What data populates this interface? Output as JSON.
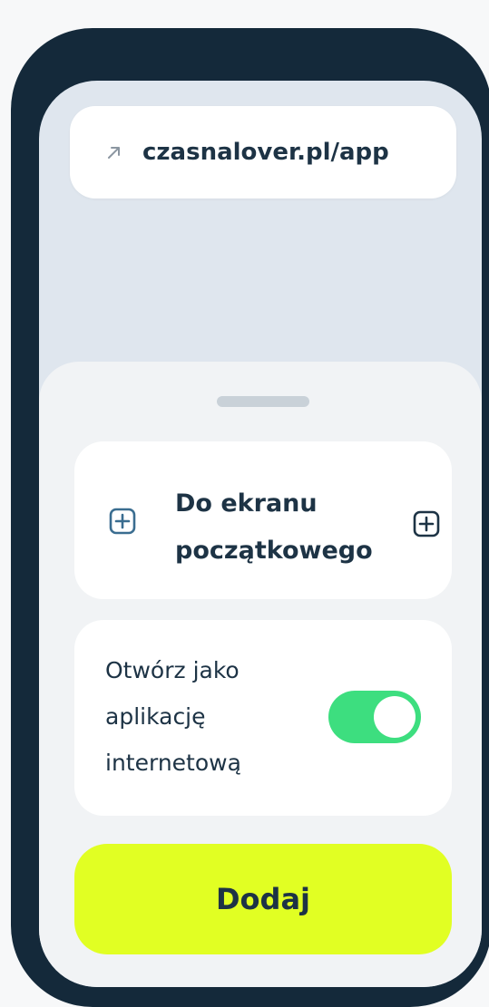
{
  "browser": {
    "url_display": "czasnalover.pl/app",
    "link_icon": "arrow-up-right-icon"
  },
  "sheet": {
    "home_screen": {
      "title": "Do ekranu początkowego",
      "left_icon": "plus-square-icon",
      "right_icon": "plus-square-icon"
    },
    "web_app_option": {
      "label": "Otwórz jako aplikację internetową",
      "toggle_on": true
    },
    "add_button_label": "Dodaj"
  },
  "colors": {
    "frame": "#14293a",
    "screen_bg": "#dfe6ee",
    "sheet_bg": "#f1f3f5",
    "text": "#1d3345",
    "toggle_on": "#3dde7f",
    "accent_button": "#e1ff23"
  }
}
